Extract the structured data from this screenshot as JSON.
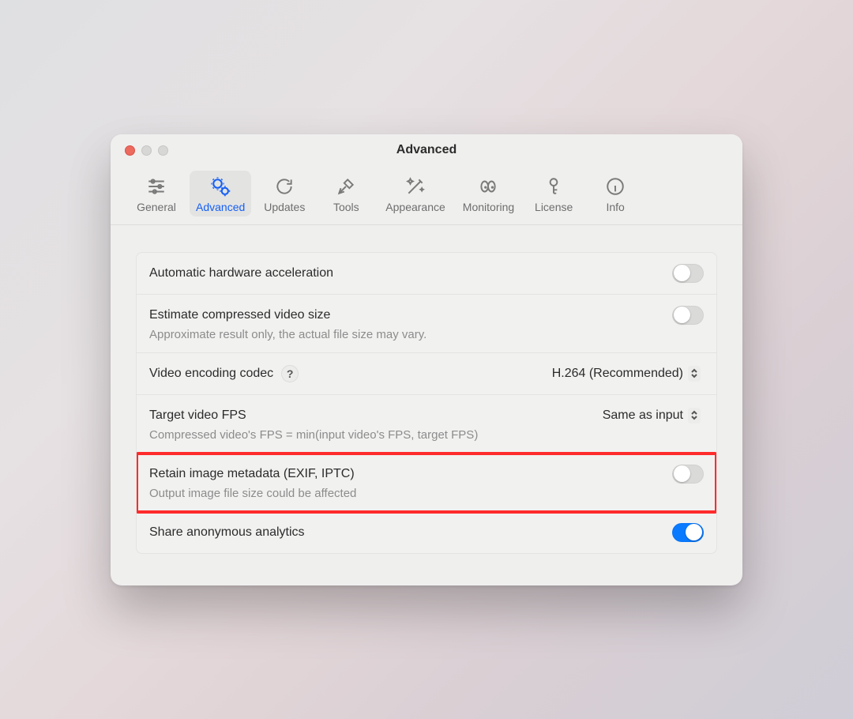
{
  "window": {
    "title": "Advanced"
  },
  "tabs": [
    {
      "label": "General"
    },
    {
      "label": "Advanced"
    },
    {
      "label": "Updates"
    },
    {
      "label": "Tools"
    },
    {
      "label": "Appearance"
    },
    {
      "label": "Monitoring"
    },
    {
      "label": "License"
    },
    {
      "label": "Info"
    }
  ],
  "settings": {
    "hwaccel": {
      "title": "Automatic hardware acceleration",
      "on": false
    },
    "estimate": {
      "title": "Estimate compressed video size",
      "sub": "Approximate result only, the actual file size may vary.",
      "on": false
    },
    "codec": {
      "title": "Video encoding codec",
      "value": "H.264 (Recommended)"
    },
    "fps": {
      "title": "Target video FPS",
      "value": "Same as input",
      "sub": "Compressed video's FPS = min(input video's FPS, target FPS)"
    },
    "metadata": {
      "title": "Retain image metadata (EXIF, IPTC)",
      "sub": "Output image file size could be affected",
      "on": false
    },
    "analytics": {
      "title": "Share anonymous analytics",
      "on": true
    }
  }
}
